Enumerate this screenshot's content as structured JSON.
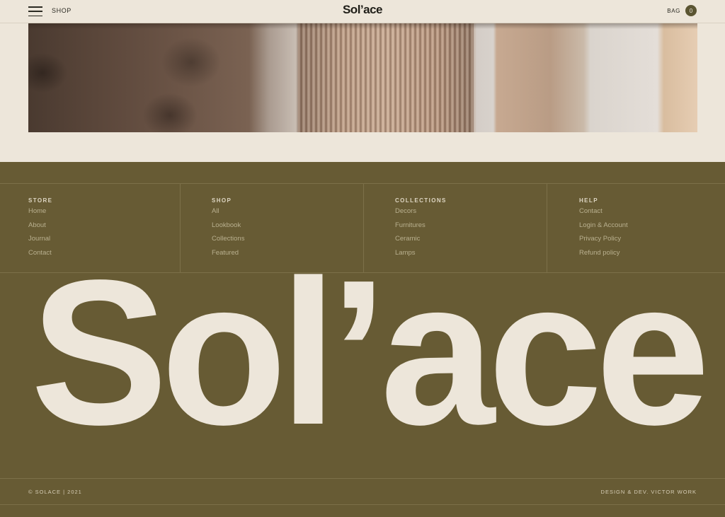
{
  "header": {
    "menu_icon": "hamburger-menu-icon",
    "shop_label": "SHOP",
    "logo_text": "Sol’ace",
    "bag_label": "BAG",
    "bag_count": "0"
  },
  "footer": {
    "columns": [
      {
        "heading": "STORE",
        "links": [
          "Home",
          "About",
          "Journal",
          "Contact"
        ]
      },
      {
        "heading": "SHOP",
        "links": [
          "All",
          "Lookbook",
          "Collections",
          "Featured"
        ]
      },
      {
        "heading": "COLLECTIONS",
        "links": [
          "Decors",
          "Furnitures",
          "Ceramic",
          "Lamps"
        ]
      },
      {
        "heading": "HELP",
        "links": [
          "Contact",
          "Login & Account",
          "Privacy Policy",
          "Refund policy"
        ]
      }
    ],
    "wordmark": "Sol’ace",
    "copyright": "© SOLACE | 2021",
    "credits": "DESIGN & DEV. VICTOR WORK"
  },
  "colors": {
    "background": "#ede6da",
    "footer_bg": "#675b34",
    "wordmark": "#ede6da",
    "text_dark": "#2b2a22"
  }
}
